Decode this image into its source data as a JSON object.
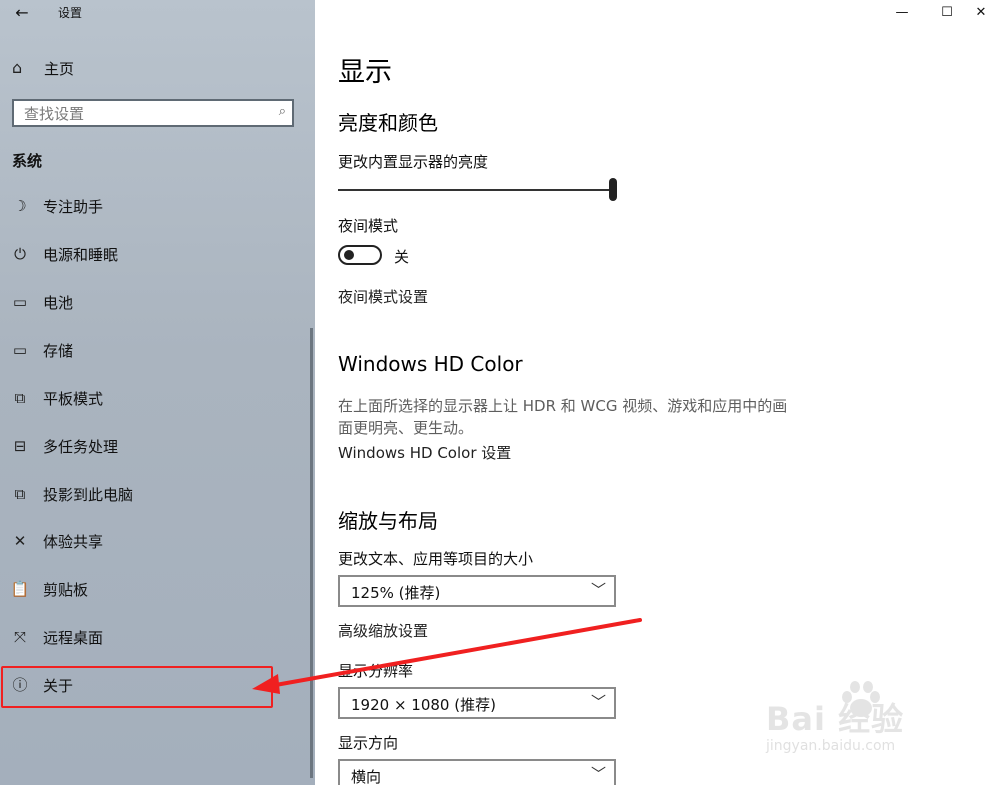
{
  "window": {
    "title": "设置",
    "back_icon": "←",
    "minimize": "—",
    "maximize": "☐",
    "close": "✕"
  },
  "sidebar": {
    "home": {
      "label": "主页",
      "icon": "⌂"
    },
    "search": {
      "placeholder": "查找设置",
      "icon": "⌕"
    },
    "section_title": "系统",
    "items": [
      {
        "label": "专注助手",
        "icon": "☽"
      },
      {
        "label": "电源和睡眠",
        "icon": "⏻"
      },
      {
        "label": "电池",
        "icon": "▭"
      },
      {
        "label": "存储",
        "icon": "▭"
      },
      {
        "label": "平板模式",
        "icon": "⧉"
      },
      {
        "label": "多任务处理",
        "icon": "⊟"
      },
      {
        "label": "投影到此电脑",
        "icon": "⧉"
      },
      {
        "label": "体验共享",
        "icon": "✕"
      },
      {
        "label": "剪贴板",
        "icon": "📋"
      },
      {
        "label": "远程桌面",
        "icon": "⤧"
      },
      {
        "label": "关于",
        "icon": "ⓘ"
      }
    ]
  },
  "main": {
    "page_title": "显示",
    "brightness_section": {
      "heading": "亮度和颜色",
      "brightness_label": "更改内置显示器的亮度",
      "brightness_value_fraction": 1.0,
      "night_light_label": "夜间模式",
      "night_light_state": "关",
      "night_light_settings_link": "夜间模式设置"
    },
    "hdr_section": {
      "heading": "Windows HD Color",
      "description": "在上面所选择的显示器上让 HDR 和 WCG 视频、游戏和应用中的画面更明亮、更生动。",
      "link": "Windows HD Color 设置"
    },
    "scale_section": {
      "heading": "缩放与布局",
      "scale_label": "更改文本、应用等项目的大小",
      "scale_value": "125% (推荐)",
      "advanced_scaling_link": "高级缩放设置",
      "resolution_label": "显示分辨率",
      "resolution_value": "1920 × 1080 (推荐)",
      "orientation_label": "显示方向",
      "orientation_value": "横向"
    },
    "chevron": "﹀"
  },
  "watermark": {
    "logo": "Bai 经验",
    "url": "jingyan.baidu.com"
  },
  "colors": {
    "annotation_red": "#f02020",
    "sidebar_bg": "#aeb8c3"
  }
}
